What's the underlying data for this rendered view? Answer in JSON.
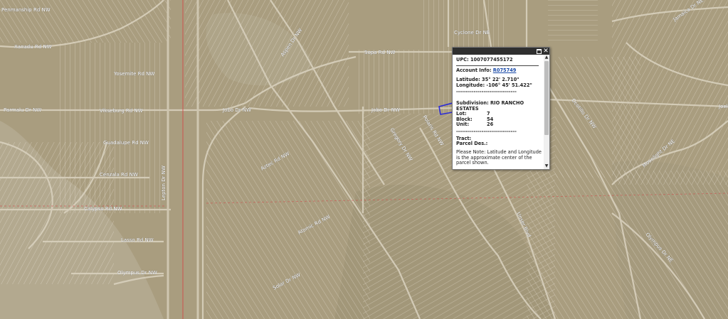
{
  "map": {
    "road_labels": [
      {
        "text": "Penmanship Rd NW"
      },
      {
        "text": "Xanadu Rd NW"
      },
      {
        "text": "Yosemite Rd NW"
      },
      {
        "text": "Vikseburg Rd NW"
      },
      {
        "text": "Guadalupe Rd NW"
      },
      {
        "text": "Calypso Rd NW"
      },
      {
        "text": "Lasso Rd NW"
      },
      {
        "text": "Olympus Dr NW"
      },
      {
        "text": "Jobo Dr NW"
      },
      {
        "text": "Jobo Dr NW"
      },
      {
        "text": "Parmalu Dr NW"
      },
      {
        "text": "Cyclone Dr NE"
      },
      {
        "text": "Sopa Rd NW"
      },
      {
        "text": "Lepton Dr NW"
      },
      {
        "text": "Cenzala Rd NW"
      },
      {
        "text": "Aspen Dr NW"
      },
      {
        "text": "Aztec Rd NW"
      },
      {
        "text": "Atomic Rd NW"
      },
      {
        "text": "Gregory Dr NW"
      },
      {
        "text": "Solar Dr NW"
      },
      {
        "text": "Polaris Rd NW"
      },
      {
        "text": "Ocotillo Dr NW"
      },
      {
        "text": "Moonlight Dr NE"
      },
      {
        "text": "Jamaica Dr NE"
      },
      {
        "text": "Joel Dr NE"
      },
      {
        "text": "Olympus Dr NE"
      },
      {
        "text": "Unser Blvd"
      }
    ],
    "boundary_line_color": "#d24a4a",
    "selected_parcel_color": "#2b2bd6",
    "imagery_color": "#a99d7f"
  },
  "popup": {
    "upc_label": "UPC:",
    "upc_value": "1007077455172",
    "account_label": "Account Info:",
    "account_value": "R075749",
    "latitude_label": "Latitude:",
    "latitude_value": "35° 22' 2.710\"",
    "longitude_label": "Longitude:",
    "longitude_value": "-106° 45' 51.422\"",
    "separator_1": "-------------------------------",
    "subdivision_label": "Subdivision:",
    "subdivision_value": "RIO RANCHO ESTATES",
    "lot_label": "Lot:",
    "lot_value": "7",
    "block_label": "Block:",
    "block_value": "54",
    "unit_label": "Unit:",
    "unit_value": "26",
    "separator_2": "-------------------------------",
    "tract_label": "Tract:",
    "parcel_des_label": "Parcel Des.:",
    "note": "Please Note: Latitude and Longitude is the approximate center of the parcel shown.",
    "maximize_icon": "maximize-icon",
    "close_glyph": "✕",
    "scroll_up_glyph": "▲",
    "scroll_down_glyph": "▼"
  }
}
